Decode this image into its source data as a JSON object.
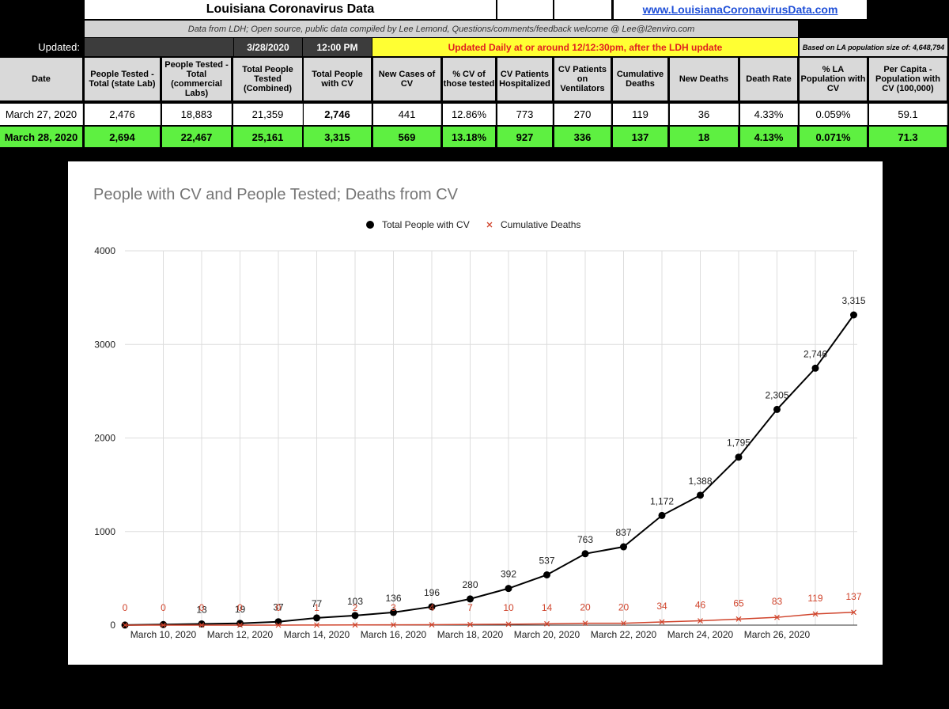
{
  "sheet": {
    "title": "Louisiana Coronavirus Data",
    "link": "www.LouisianaCoronavirusData.com",
    "credit": "Data from LDH; Open source, public data compiled by Lee Lemond, Questions/comments/feedback welcome @ Lee@l2enviro.com",
    "updated_label": "Updated:",
    "updated_date": "3/28/2020",
    "updated_time": "12:00 PM",
    "schedule_note": "Updated Daily at or around 12/12:30pm, after the LDH update",
    "population_note": "Based on LA population size of: 4,648,794"
  },
  "table": {
    "headers": [
      "Date",
      "People Tested - Total (state Lab)",
      "People Tested - Total (commercial Labs)",
      "Total People Tested (Combined)",
      "Total People with CV",
      "New Cases of CV",
      "% CV of those tested",
      "CV Patients Hospitalized",
      "CV Patients on Ventilators",
      "Cumulative Deaths",
      "New Deaths",
      "Death Rate",
      "% LA Population with CV",
      "Per Capita - Population with CV (100,000)"
    ],
    "rows": [
      [
        "March 27, 2020",
        "2,476",
        "18,883",
        "21,359",
        "2,746",
        "441",
        "12.86%",
        "773",
        "270",
        "119",
        "36",
        "4.33%",
        "0.059%",
        "59.1"
      ],
      [
        "March 28, 2020",
        "2,694",
        "22,467",
        "25,161",
        "3,315",
        "569",
        "13.18%",
        "927",
        "336",
        "137",
        "18",
        "4.13%",
        "0.071%",
        "71.3"
      ]
    ]
  },
  "chart_data": {
    "type": "line",
    "title": "People with CV and People Tested; Deaths from CV",
    "x": [
      "March 9, 2020",
      "March 10, 2020",
      "March 11, 2020",
      "March 12, 2020",
      "March 13, 2020",
      "March 14, 2020",
      "March 15, 2020",
      "March 16, 2020",
      "March 17, 2020",
      "March 18, 2020",
      "March 19, 2020",
      "March 20, 2020",
      "March 21, 2020",
      "March 22, 2020",
      "March 23, 2020",
      "March 24, 2020",
      "March 25, 2020",
      "March 26, 2020",
      "March 27, 2020",
      "March 28, 2020"
    ],
    "xtick_labels": [
      "March 10, 2020",
      "March 12, 2020",
      "March 14, 2020",
      "March 16, 2020",
      "March 18, 2020",
      "March 20, 2020",
      "March 22, 2020",
      "March 24, 2020",
      "March 26, 2020"
    ],
    "series": [
      {
        "name": "Total People with CV",
        "color": "#000000",
        "marker": "circle",
        "values": [
          1,
          6,
          13,
          19,
          36,
          77,
          103,
          136,
          196,
          280,
          392,
          537,
          763,
          837,
          1172,
          1388,
          1795,
          2305,
          2746,
          3315
        ],
        "labels": [
          "",
          "",
          "13",
          "19",
          "37",
          "77",
          "103",
          "136",
          "196",
          "280",
          "392",
          "537",
          "763",
          "837",
          "1,172",
          "1,388",
          "1,795",
          "2,305",
          "2,746",
          "3,315"
        ]
      },
      {
        "name": "Cumulative Deaths",
        "color": "#d0442c",
        "marker": "x",
        "values": [
          0,
          0,
          0,
          0,
          0,
          1,
          2,
          3,
          4,
          7,
          10,
          14,
          20,
          20,
          34,
          46,
          65,
          83,
          119,
          137
        ]
      }
    ],
    "ylim": [
      0,
      4000
    ],
    "yticks": [
      0,
      1000,
      2000,
      3000,
      4000
    ],
    "grid": true,
    "legend": "top"
  }
}
